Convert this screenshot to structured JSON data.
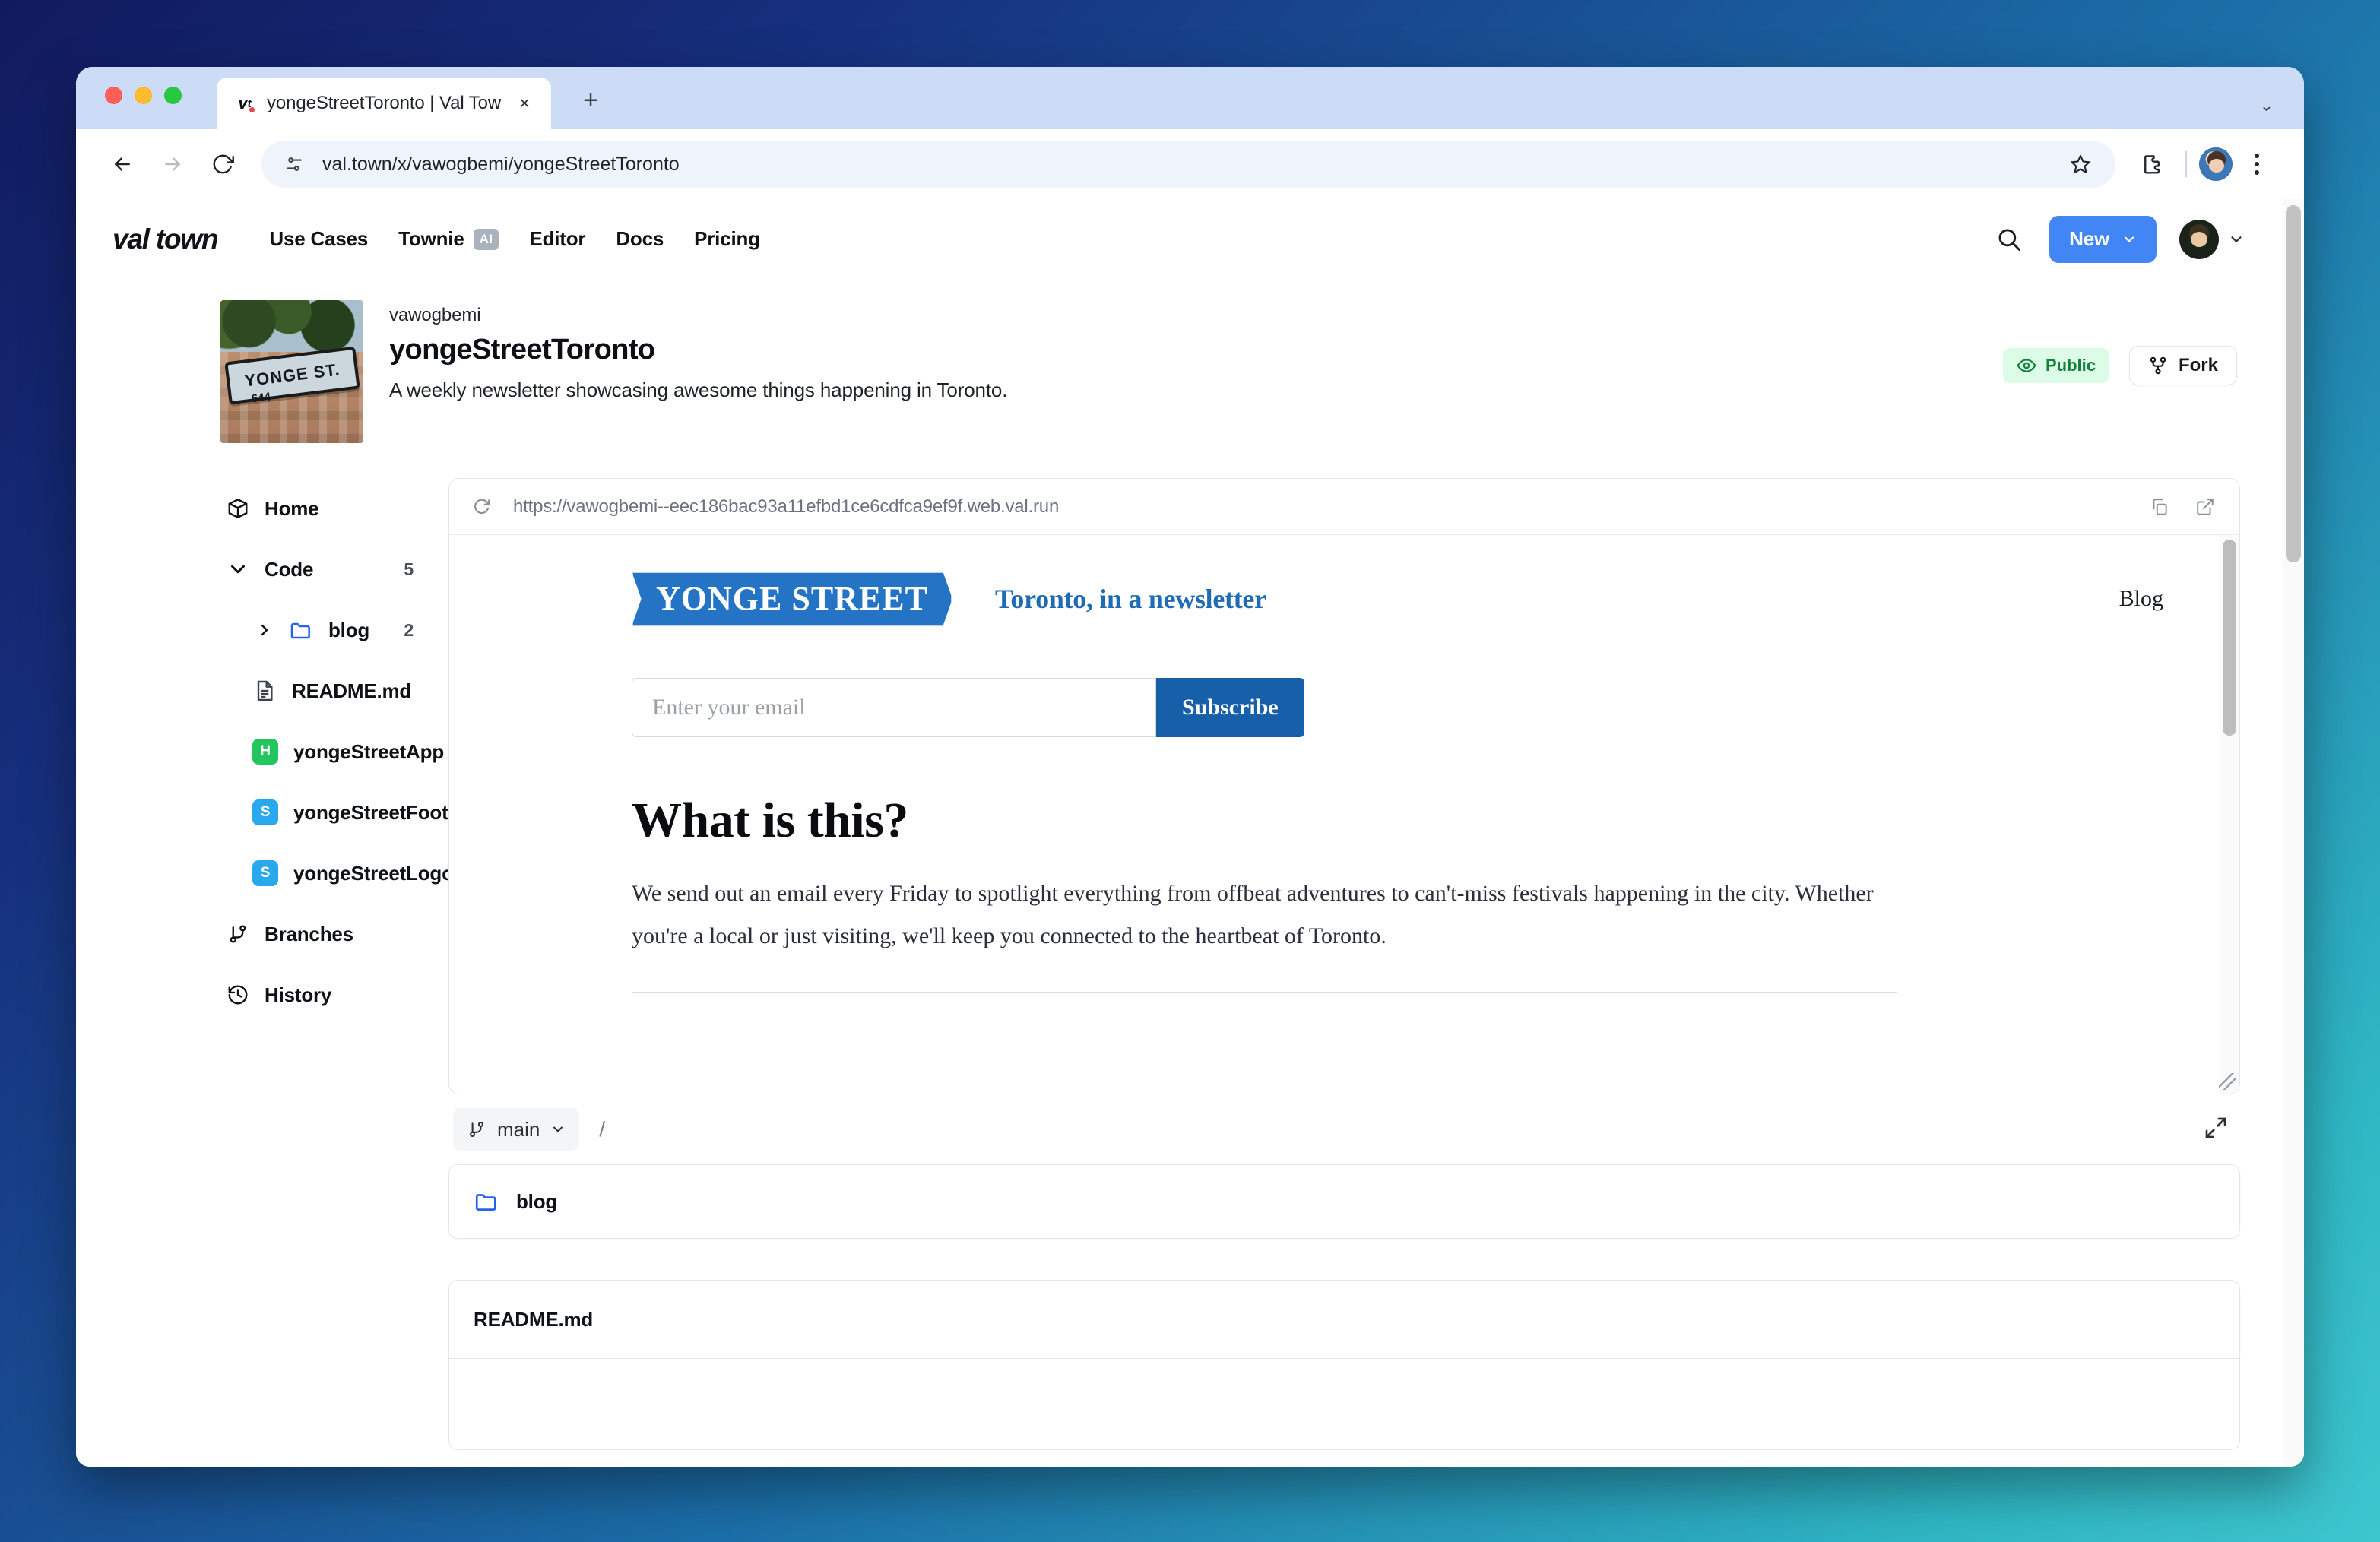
{
  "browser": {
    "tab": {
      "title": "yongeStreetToronto | Val Tow",
      "favicon": "val-town-favicon",
      "close_label": "×"
    },
    "new_tab_label": "+",
    "tab_list_caret": "⌄",
    "toolbar": {
      "back_label": "←",
      "forward_label": "→",
      "reload_label": "⟳",
      "url": "val.town/x/vawogbemi/yongeStreetToronto",
      "site_info_icon": "tune-icon",
      "bookmark_icon": "star-icon",
      "extensions_icon": "puzzle-piece-icon",
      "profile_icon": "profile-avatar",
      "menu_icon": "kebab-menu-icon"
    }
  },
  "nav": {
    "logo": "val town",
    "links": [
      {
        "label": "Use Cases",
        "badge": null
      },
      {
        "label": "Townie",
        "badge": "AI"
      },
      {
        "label": "Editor",
        "badge": null
      },
      {
        "label": "Docs",
        "badge": null
      },
      {
        "label": "Pricing",
        "badge": null
      }
    ],
    "search_icon": "search-icon",
    "new_button": "New",
    "new_button_caret": "⌄",
    "user_caret": "⌄"
  },
  "project": {
    "owner": "vawogbemi",
    "title": "yongeStreetToronto",
    "description": "A weekly newsletter showcasing awesome things happening in Toronto.",
    "thumbnail_sign_text": "YONGE   ST.",
    "thumbnail_sign_number": "644",
    "visibility_badge": "Public",
    "visibility_icon": "eye-icon",
    "fork_button": "Fork",
    "fork_icon": "fork-icon"
  },
  "sidebar": {
    "items": [
      {
        "label": "Home",
        "icon": "box-icon",
        "count": "",
        "kind": "root"
      },
      {
        "label": "Code",
        "icon": "chevron-down-icon",
        "count": "5",
        "kind": "section"
      },
      {
        "label": "blog",
        "icon": "folder-icon",
        "count": "2",
        "kind": "folder"
      },
      {
        "label": "README.md",
        "icon": "file-icon",
        "count": "",
        "kind": "file"
      },
      {
        "label": "yongeStreetApp",
        "icon": "http-val-icon",
        "badge": "H",
        "count": "",
        "kind": "file"
      },
      {
        "label": "yongeStreetFooter",
        "icon": "script-val-icon",
        "badge": "S",
        "count": "",
        "kind": "file"
      },
      {
        "label": "yongeStreetLogo",
        "icon": "script-val-icon",
        "badge": "S",
        "count": "",
        "kind": "file"
      },
      {
        "label": "Branches",
        "icon": "branch-icon",
        "count": "",
        "kind": "root"
      },
      {
        "label": "History",
        "icon": "history-icon",
        "count": "",
        "kind": "root"
      }
    ]
  },
  "preview": {
    "reload_icon": "reload-icon",
    "url": "https://vawogbemi--eec186bac93a11efbd1ce6cdfca9ef9f.web.val.run",
    "copy_icon": "copy-icon",
    "open_external_icon": "open-external-icon",
    "site": {
      "logo_text": "YONGE STREET",
      "tagline": "Toronto, in a newsletter",
      "nav_link": "Blog",
      "email_placeholder": "Enter your email",
      "email_value": "",
      "subscribe_label": "Subscribe",
      "heading": "What is this?",
      "paragraph": "We send out an email every Friday to spotlight everything from offbeat adventures to can't-miss festivals happening in the city. Whether you're a local or just visiting, we'll keep you connected to the heartbeat of Toronto."
    }
  },
  "file_browser": {
    "branch": "main",
    "branch_icon": "branch-icon",
    "branch_caret": "⌄",
    "path_separator": "/",
    "expand_icon": "expand-icon",
    "entries": [
      {
        "name": "blog",
        "icon": "folder-icon",
        "type": "folder"
      },
      {
        "name": "README.md",
        "icon": "readme-icon",
        "type": "file"
      }
    ]
  },
  "colors": {
    "brand_blue": "#4285f4",
    "public_green": "#15803d",
    "public_green_bg": "#dcfce7",
    "newsletter_blue": "#2573c4",
    "subscribe_blue": "#175fa8",
    "http_val_green": "#22c55e",
    "script_val_blue": "#2aa8ee"
  }
}
